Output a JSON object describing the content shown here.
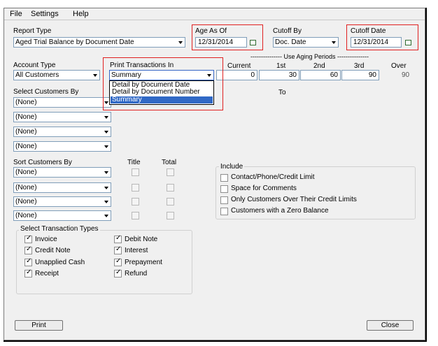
{
  "menu": {
    "file": "File",
    "settings": "Settings",
    "help": "Help"
  },
  "report_type": {
    "label": "Report Type",
    "value": "Aged Trial Balance by Document Date"
  },
  "age_as_of": {
    "label": "Age As Of",
    "value": "12/31/2014"
  },
  "cutoff_by": {
    "label": "Cutoff By",
    "value": "Doc. Date"
  },
  "cutoff_date": {
    "label": "Cutoff Date",
    "value": "12/31/2014"
  },
  "aging": {
    "header": "--------------- Use Aging Periods ---------------",
    "columns": [
      "Current",
      "1st",
      "2nd",
      "3rd",
      "Over"
    ],
    "values": [
      "0",
      "30",
      "60",
      "90",
      "90"
    ]
  },
  "account_type": {
    "label": "Account Type",
    "value": "All Customers"
  },
  "print_transactions": {
    "label": "Print Transactions In",
    "value": "Summary",
    "options": [
      "Detail by Document Date",
      "Detail by Document Number",
      "Summary"
    ]
  },
  "select_customers": {
    "label": "Select Customers By",
    "to_label": "To",
    "values": [
      "(None)",
      "(None)",
      "(None)",
      "(None)"
    ]
  },
  "sort_customers": {
    "label": "Sort Customers By",
    "title_col": "Title",
    "total_col": "Total",
    "values": [
      "(None)",
      "(None)",
      "(None)",
      "(None)"
    ]
  },
  "include": {
    "label": "Include",
    "items": [
      "Contact/Phone/Credit Limit",
      "Space for Comments",
      "Only Customers Over Their Credit Limits",
      "Customers with a Zero Balance"
    ]
  },
  "transaction_types": {
    "label": "Select Transaction Types",
    "left": [
      "Invoice",
      "Credit Note",
      "Unapplied Cash",
      "Receipt"
    ],
    "right": [
      "Debit Note",
      "Interest",
      "Prepayment",
      "Refund"
    ]
  },
  "buttons": {
    "print": "Print",
    "close": "Close"
  },
  "colors": {
    "highlight": "#e02020",
    "selection": "#3169c6"
  }
}
